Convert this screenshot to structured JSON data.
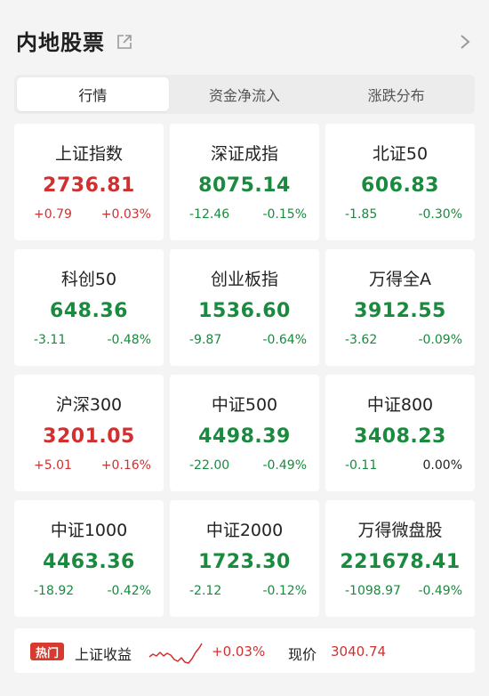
{
  "header": {
    "title": "内地股票",
    "icons": [
      "share-icon",
      "chevron-right-icon"
    ]
  },
  "tabs": [
    {
      "label": "行情",
      "active": true
    },
    {
      "label": "资金净流入",
      "active": false
    },
    {
      "label": "涨跌分布",
      "active": false
    }
  ],
  "colors": {
    "up": "#d0302f",
    "down": "#1a8a3e",
    "neutral": "#222222"
  },
  "indices": [
    {
      "name": "上证指数",
      "value": "2736.81",
      "change": "+0.79",
      "pct": "+0.03%",
      "trend": "up"
    },
    {
      "name": "深证成指",
      "value": "8075.14",
      "change": "-12.46",
      "pct": "-0.15%",
      "trend": "down"
    },
    {
      "name": "北证50",
      "value": "606.83",
      "change": "-1.85",
      "pct": "-0.30%",
      "trend": "down"
    },
    {
      "name": "科创50",
      "value": "648.36",
      "change": "-3.11",
      "pct": "-0.48%",
      "trend": "down"
    },
    {
      "name": "创业板指",
      "value": "1536.60",
      "change": "-9.87",
      "pct": "-0.64%",
      "trend": "down"
    },
    {
      "name": "万得全A",
      "value": "3912.55",
      "change": "-3.62",
      "pct": "-0.09%",
      "trend": "down"
    },
    {
      "name": "沪深300",
      "value": "3201.05",
      "change": "+5.01",
      "pct": "+0.16%",
      "trend": "up"
    },
    {
      "name": "中证500",
      "value": "4498.39",
      "change": "-22.00",
      "pct": "-0.49%",
      "trend": "down"
    },
    {
      "name": "中证800",
      "value": "3408.23",
      "change": "-0.11",
      "pct": "0.00%",
      "trend": "down",
      "pct_trend": "neutral"
    },
    {
      "name": "中证1000",
      "value": "4463.36",
      "change": "-18.92",
      "pct": "-0.42%",
      "trend": "down"
    },
    {
      "name": "中证2000",
      "value": "1723.30",
      "change": "-2.12",
      "pct": "-0.12%",
      "trend": "down"
    },
    {
      "name": "万得微盘股",
      "value": "221678.41",
      "change": "-1098.97",
      "pct": "-0.49%",
      "trend": "down"
    }
  ],
  "ticker": {
    "badge": "热门",
    "label": "上证收益",
    "pct": "+0.03%",
    "price_label": "现价",
    "price": "3040.74",
    "sparkline_icon": "sparkline-icon"
  }
}
